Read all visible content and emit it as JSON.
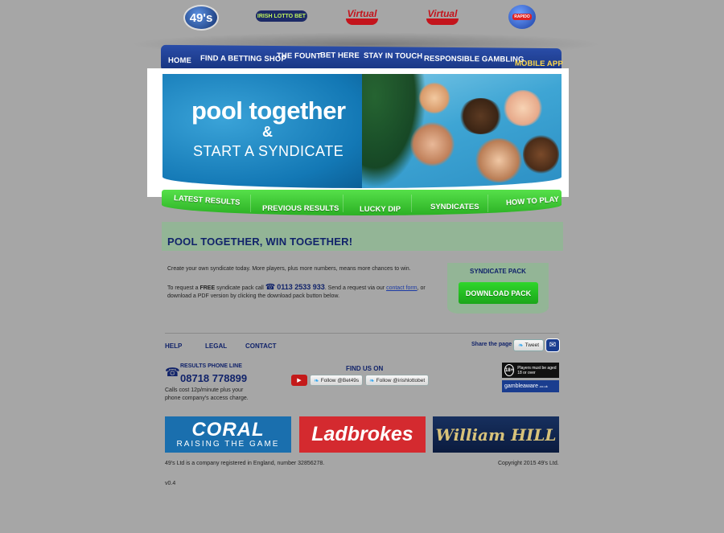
{
  "top_logos": {
    "bet49s": "49's",
    "irish_lotto": "IRISH LOTTO BET",
    "virtual1": "Virtual",
    "virtual2": "Virtual",
    "rapido": "RAPIDO"
  },
  "main_nav": {
    "items": [
      "HOME",
      "FIND A BETTING SHOP",
      "THE FOUNT",
      "BET HERE",
      "STAY IN TOUCH",
      "RESPONSIBLE GAMBLING",
      "MOBILE APP"
    ]
  },
  "banner": {
    "line1": "pool together",
    "amp": "&",
    "line2": "START A SYNDICATE"
  },
  "sub_nav": {
    "items": [
      "LATEST RESULTS",
      "PREVIOUS RESULTS",
      "LUCKY DIP",
      "SYNDICATES",
      "HOW TO PLAY"
    ]
  },
  "page": {
    "title": "POOL TOGETHER, WIN TOGETHER!",
    "intro": "Create your own syndicate today. More players, plus more numbers, means more chances to win.",
    "request_prefix": "To request a ",
    "request_free": "FREE",
    "request_mid": " syndicate pack call ",
    "request_phone": "0113 2533 933",
    "request_after_phone": ". Send a request via our ",
    "request_link": "contact form",
    "request_suffix": ", or download a PDF version by clicking the download pack button below."
  },
  "syndicate_pack": {
    "title": "SYNDICATE PACK",
    "button": "DOWNLOAD PACK"
  },
  "footer": {
    "links": [
      "HELP",
      "LEGAL",
      "CONTACT"
    ],
    "share_label": "Share the page",
    "tweet": "Tweet",
    "results_label": "RESULTS PHONE LINE",
    "results_phone": "08718 778899",
    "call_cost": "Calls cost 12p/minute plus your phone company's access charge.",
    "find_us": "FIND US ON",
    "follow1": "Follow @Bet49s",
    "follow2": "Follow @irishlottobet",
    "age_badge": "18+",
    "age_text": "Players must be aged 18 or over",
    "gamble_aware": "gambleaware",
    "gamble_aware_suffix": ".co.uk",
    "coral": "CORAL",
    "coral_tag": "RAISING THE GAME",
    "ladbrokes": "Ladbrokes",
    "william_hill": "William HILL",
    "company_info": "49's Ltd is a company registered in England, number 32856278.",
    "copyright": "Copyright 2015 49's Ltd.",
    "version": "v0.4"
  },
  "colors": {
    "page_bg": "#a6a6a6",
    "nav_blue": "#14307a",
    "green_nav": "#2bb024",
    "title_strip": "#93b596",
    "heading_navy": "#11236a"
  }
}
